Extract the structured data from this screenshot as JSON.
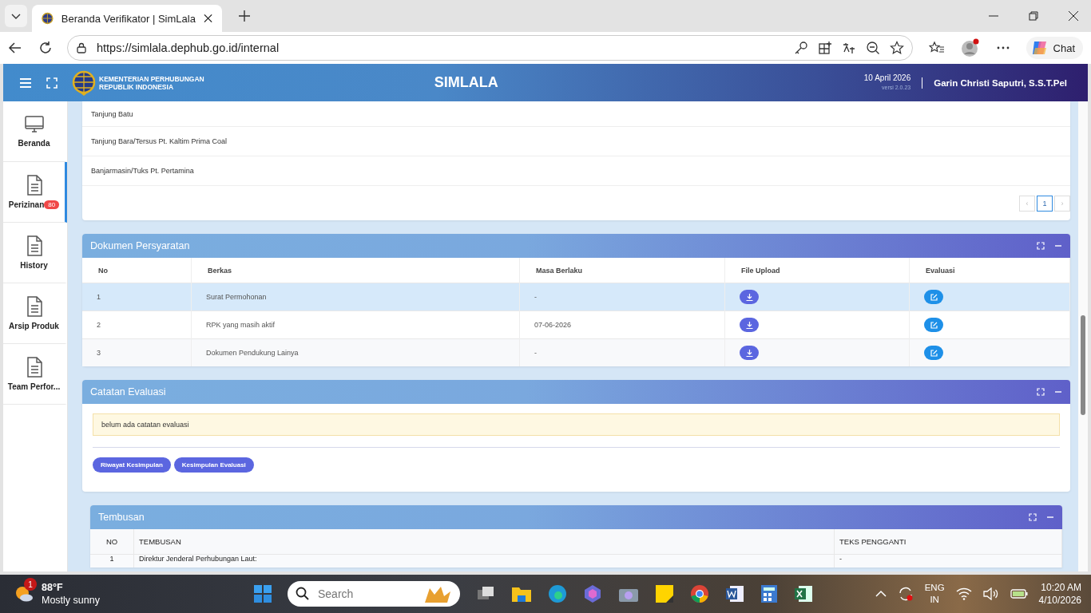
{
  "browser": {
    "tabs": [
      {
        "title": "Beranda Verifikator | SimLala",
        "selected": true
      }
    ],
    "url": "https://simlala.dephub.go.id/internal",
    "chat_label": "Chat"
  },
  "app_header": {
    "org_line1": "KEMENTERIAN PERHUBUNGAN",
    "org_line2": "REPUBLIK INDONESIA",
    "title": "SIMLALA",
    "date": "10 April 2026",
    "version": "versi 2.0.23",
    "user": "Garin Christi Saputri, S.S.T.Pel"
  },
  "sidebar": {
    "items": [
      {
        "label": "Beranda",
        "kind": "monitor",
        "selected": false
      },
      {
        "label": "Perizinan",
        "kind": "document",
        "badge": "80",
        "selected": true
      },
      {
        "label": "History",
        "kind": "document",
        "selected": false
      },
      {
        "label": "Arsip Produk",
        "kind": "document",
        "selected": false
      },
      {
        "label": "Team Perfor...",
        "kind": "document",
        "selected": false
      }
    ]
  },
  "ports_card": {
    "rows": [
      "Tanjung Batu",
      "Tanjung Bara/Tersus Pt. Kaltim Prima Coal",
      "Banjarmasin/Tuks Pt. Pertamina"
    ],
    "prev": "‹",
    "pages": [
      {
        "label": "1",
        "selected": true
      }
    ],
    "next": "›"
  },
  "dokumen": {
    "title": "Dokumen Persyaratan",
    "columns": [
      "No",
      "Berkas",
      "Masa Berlaku",
      "File Upload",
      "Evaluasi"
    ],
    "rows": [
      {
        "no": "1",
        "berkas": "Surat Permohonan",
        "masa_berlaku": "-",
        "selected": true
      },
      {
        "no": "2",
        "berkas": "RPK yang masih aktif",
        "masa_berlaku": "07-06-2026",
        "selected": false
      },
      {
        "no": "3",
        "berkas": "Dokumen Pendukung Lainya",
        "masa_berlaku": "-",
        "selected": false
      }
    ]
  },
  "catatan": {
    "title": "Catatan Evaluasi",
    "note": "belum ada catatan evaluasi",
    "buttons": [
      "Riwayat Kesimpulan",
      "Kesimpulan Evaluasi"
    ]
  },
  "tembusan": {
    "title": "Tembusan",
    "columns": [
      "NO",
      "TEMBUSAN",
      "TEKS PENGGANTI"
    ],
    "rows": [
      {
        "no": "1",
        "tembusan": "Direktur Jenderal Perhubungan Laut:",
        "teks_pengganti": "-"
      }
    ]
  },
  "taskbar": {
    "weather": {
      "badge": "1",
      "temp": "88°F",
      "desc": "Mostly sunny"
    },
    "search_placeholder": "Search",
    "lang": "ENG",
    "region": "IN",
    "time": "10:20 AM",
    "date": "4/10/2026"
  }
}
